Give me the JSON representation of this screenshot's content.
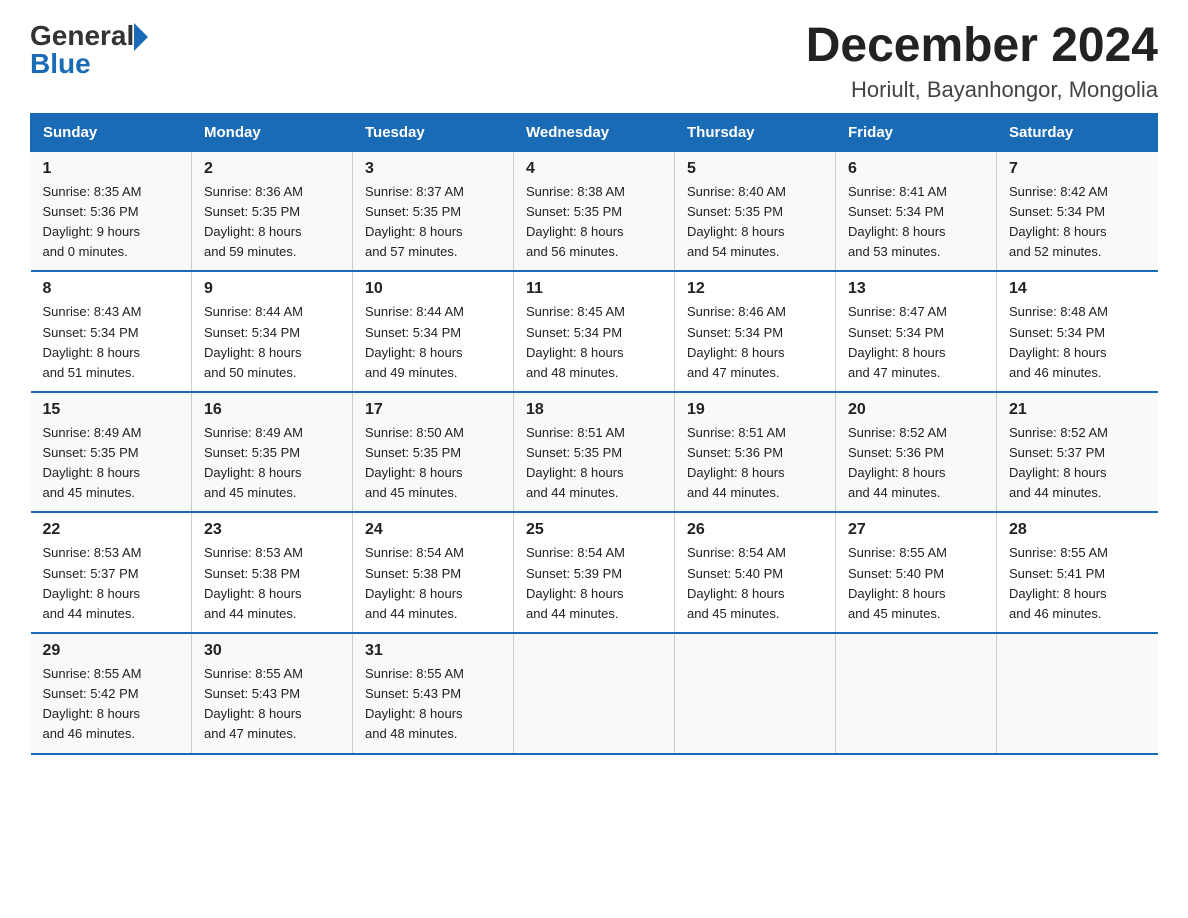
{
  "header": {
    "logo_general": "General",
    "logo_blue": "Blue",
    "month_year": "December 2024",
    "location": "Horiult, Bayanhongor, Mongolia"
  },
  "days_of_week": [
    "Sunday",
    "Monday",
    "Tuesday",
    "Wednesday",
    "Thursday",
    "Friday",
    "Saturday"
  ],
  "weeks": [
    [
      {
        "day": "1",
        "sunrise": "8:35 AM",
        "sunset": "5:36 PM",
        "daylight": "9 hours and 0 minutes."
      },
      {
        "day": "2",
        "sunrise": "8:36 AM",
        "sunset": "5:35 PM",
        "daylight": "8 hours and 59 minutes."
      },
      {
        "day": "3",
        "sunrise": "8:37 AM",
        "sunset": "5:35 PM",
        "daylight": "8 hours and 57 minutes."
      },
      {
        "day": "4",
        "sunrise": "8:38 AM",
        "sunset": "5:35 PM",
        "daylight": "8 hours and 56 minutes."
      },
      {
        "day": "5",
        "sunrise": "8:40 AM",
        "sunset": "5:35 PM",
        "daylight": "8 hours and 54 minutes."
      },
      {
        "day": "6",
        "sunrise": "8:41 AM",
        "sunset": "5:34 PM",
        "daylight": "8 hours and 53 minutes."
      },
      {
        "day": "7",
        "sunrise": "8:42 AM",
        "sunset": "5:34 PM",
        "daylight": "8 hours and 52 minutes."
      }
    ],
    [
      {
        "day": "8",
        "sunrise": "8:43 AM",
        "sunset": "5:34 PM",
        "daylight": "8 hours and 51 minutes."
      },
      {
        "day": "9",
        "sunrise": "8:44 AM",
        "sunset": "5:34 PM",
        "daylight": "8 hours and 50 minutes."
      },
      {
        "day": "10",
        "sunrise": "8:44 AM",
        "sunset": "5:34 PM",
        "daylight": "8 hours and 49 minutes."
      },
      {
        "day": "11",
        "sunrise": "8:45 AM",
        "sunset": "5:34 PM",
        "daylight": "8 hours and 48 minutes."
      },
      {
        "day": "12",
        "sunrise": "8:46 AM",
        "sunset": "5:34 PM",
        "daylight": "8 hours and 47 minutes."
      },
      {
        "day": "13",
        "sunrise": "8:47 AM",
        "sunset": "5:34 PM",
        "daylight": "8 hours and 47 minutes."
      },
      {
        "day": "14",
        "sunrise": "8:48 AM",
        "sunset": "5:34 PM",
        "daylight": "8 hours and 46 minutes."
      }
    ],
    [
      {
        "day": "15",
        "sunrise": "8:49 AM",
        "sunset": "5:35 PM",
        "daylight": "8 hours and 45 minutes."
      },
      {
        "day": "16",
        "sunrise": "8:49 AM",
        "sunset": "5:35 PM",
        "daylight": "8 hours and 45 minutes."
      },
      {
        "day": "17",
        "sunrise": "8:50 AM",
        "sunset": "5:35 PM",
        "daylight": "8 hours and 45 minutes."
      },
      {
        "day": "18",
        "sunrise": "8:51 AM",
        "sunset": "5:35 PM",
        "daylight": "8 hours and 44 minutes."
      },
      {
        "day": "19",
        "sunrise": "8:51 AM",
        "sunset": "5:36 PM",
        "daylight": "8 hours and 44 minutes."
      },
      {
        "day": "20",
        "sunrise": "8:52 AM",
        "sunset": "5:36 PM",
        "daylight": "8 hours and 44 minutes."
      },
      {
        "day": "21",
        "sunrise": "8:52 AM",
        "sunset": "5:37 PM",
        "daylight": "8 hours and 44 minutes."
      }
    ],
    [
      {
        "day": "22",
        "sunrise": "8:53 AM",
        "sunset": "5:37 PM",
        "daylight": "8 hours and 44 minutes."
      },
      {
        "day": "23",
        "sunrise": "8:53 AM",
        "sunset": "5:38 PM",
        "daylight": "8 hours and 44 minutes."
      },
      {
        "day": "24",
        "sunrise": "8:54 AM",
        "sunset": "5:38 PM",
        "daylight": "8 hours and 44 minutes."
      },
      {
        "day": "25",
        "sunrise": "8:54 AM",
        "sunset": "5:39 PM",
        "daylight": "8 hours and 44 minutes."
      },
      {
        "day": "26",
        "sunrise": "8:54 AM",
        "sunset": "5:40 PM",
        "daylight": "8 hours and 45 minutes."
      },
      {
        "day": "27",
        "sunrise": "8:55 AM",
        "sunset": "5:40 PM",
        "daylight": "8 hours and 45 minutes."
      },
      {
        "day": "28",
        "sunrise": "8:55 AM",
        "sunset": "5:41 PM",
        "daylight": "8 hours and 46 minutes."
      }
    ],
    [
      {
        "day": "29",
        "sunrise": "8:55 AM",
        "sunset": "5:42 PM",
        "daylight": "8 hours and 46 minutes."
      },
      {
        "day": "30",
        "sunrise": "8:55 AM",
        "sunset": "5:43 PM",
        "daylight": "8 hours and 47 minutes."
      },
      {
        "day": "31",
        "sunrise": "8:55 AM",
        "sunset": "5:43 PM",
        "daylight": "8 hours and 48 minutes."
      },
      null,
      null,
      null,
      null
    ]
  ]
}
